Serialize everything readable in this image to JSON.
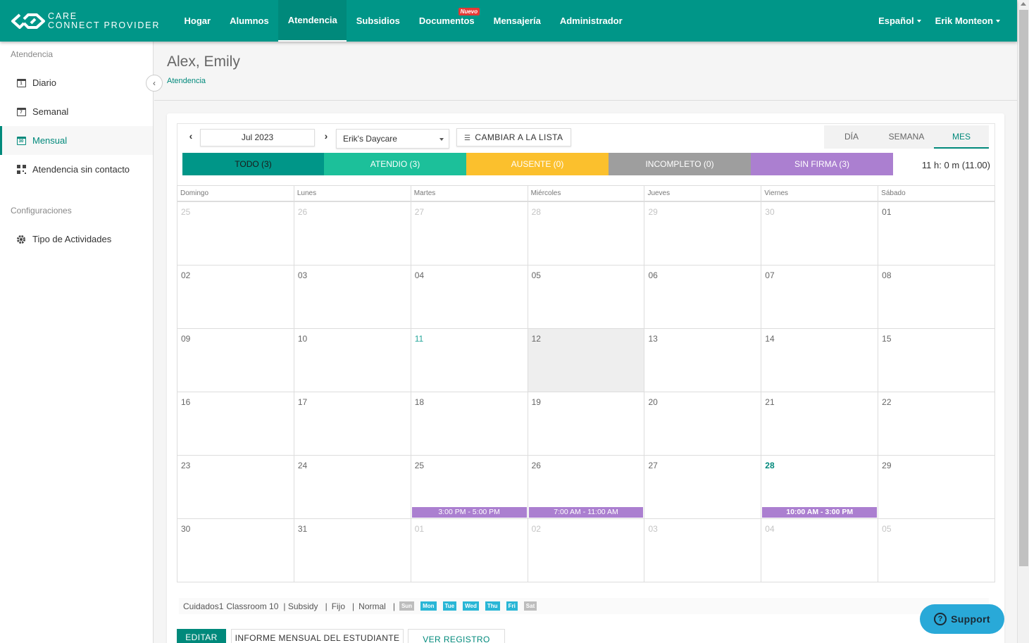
{
  "brand": {
    "line1": "CARE",
    "line2": "CONNECT PROVIDER"
  },
  "nav": {
    "items": [
      {
        "label": "Hogar"
      },
      {
        "label": "Alumnos"
      },
      {
        "label": "Atendencia",
        "active": true
      },
      {
        "label": "Subsidios"
      },
      {
        "label": "Documentos",
        "badge": "Nuevo"
      },
      {
        "label": "Mensajería"
      },
      {
        "label": "Administrador"
      }
    ],
    "language": "Español",
    "user": "Erik Monteon"
  },
  "sidebar": {
    "section1": "Atendencia",
    "items": [
      {
        "label": "Diario",
        "icon": "calendar-day-icon",
        "num": "1"
      },
      {
        "label": "Semanal",
        "icon": "calendar-week-icon",
        "num": "7"
      },
      {
        "label": "Mensual",
        "icon": "calendar-month-icon",
        "num": "30",
        "active": true
      },
      {
        "label": "Atendencia sin contacto",
        "icon": "qr-code-icon"
      }
    ],
    "section2": "Configuraciones",
    "settings_items": [
      {
        "label": "Tipo de Actividades",
        "icon": "gear-icon"
      }
    ]
  },
  "header": {
    "title": "Alex, Emily",
    "breadcrumb": "Atendencia"
  },
  "toolbar": {
    "month": "Jul 2023",
    "daycare": "Erik's Daycare",
    "list_button": "CAMBIAR A LA LISTA",
    "views": [
      "DÍA",
      "SEMANA",
      "MES"
    ],
    "active_view": "MES"
  },
  "filters": [
    {
      "label": "TODO (3)",
      "color": "#009688",
      "text_color": "#1a1a1a"
    },
    {
      "label": "ATENDIO (3)",
      "color": "#1cc09a",
      "text_color": "#ffffff"
    },
    {
      "label": "AUSENTE (0)",
      "color": "#fbc02d",
      "text_color": "#ffffff"
    },
    {
      "label": "INCOMPLETO (0)",
      "color": "#9e9e9e",
      "text_color": "#ffffff"
    },
    {
      "label": "SIN FIRMA (3)",
      "color": "#ab7fd0",
      "text_color": "#ffffff"
    }
  ],
  "total_hours": "11 h: 0 m (11.00)",
  "calendar": {
    "weekdays": [
      "Domingo",
      "Lunes",
      "Martes",
      "Miércoles",
      "Jueves",
      "Viernes",
      "Sábado"
    ],
    "weeks": [
      [
        {
          "d": "25",
          "muted": true
        },
        {
          "d": "26",
          "muted": true
        },
        {
          "d": "27",
          "muted": true
        },
        {
          "d": "28",
          "muted": true
        },
        {
          "d": "29",
          "muted": true
        },
        {
          "d": "30",
          "muted": true
        },
        {
          "d": "01"
        }
      ],
      [
        {
          "d": "02"
        },
        {
          "d": "03"
        },
        {
          "d": "04"
        },
        {
          "d": "05"
        },
        {
          "d": "06"
        },
        {
          "d": "07"
        },
        {
          "d": "08"
        }
      ],
      [
        {
          "d": "09"
        },
        {
          "d": "10"
        },
        {
          "d": "11",
          "green": true
        },
        {
          "d": "12",
          "today": true
        },
        {
          "d": "13"
        },
        {
          "d": "14"
        },
        {
          "d": "15"
        }
      ],
      [
        {
          "d": "16"
        },
        {
          "d": "17"
        },
        {
          "d": "18"
        },
        {
          "d": "19"
        },
        {
          "d": "20"
        },
        {
          "d": "21"
        },
        {
          "d": "22"
        }
      ],
      [
        {
          "d": "23"
        },
        {
          "d": "24"
        },
        {
          "d": "25",
          "event": "3:00 PM - 5:00 PM"
        },
        {
          "d": "26",
          "event": "7:00 AM - 11:00 AM"
        },
        {
          "d": "27"
        },
        {
          "d": "28",
          "bold": true,
          "event": "10:00 AM - 3:00 PM"
        },
        {
          "d": "29"
        }
      ],
      [
        {
          "d": "30"
        },
        {
          "d": "31"
        },
        {
          "d": "01",
          "muted": true
        },
        {
          "d": "02",
          "muted": true
        },
        {
          "d": "03",
          "muted": true
        },
        {
          "d": "04",
          "muted": true
        },
        {
          "d": "05",
          "muted": true
        }
      ]
    ]
  },
  "legend": {
    "care": "Cuidados1",
    "classroom": "Classroom 10",
    "subsidy": "| Subsidy",
    "type": "Fijo",
    "schedule": "Normal",
    "days": [
      {
        "label": "Sun",
        "on": false
      },
      {
        "label": "Mon",
        "on": true
      },
      {
        "label": "Tue",
        "on": true
      },
      {
        "label": "Wed",
        "on": true
      },
      {
        "label": "Thu",
        "on": true
      },
      {
        "label": "Fri",
        "on": true
      },
      {
        "label": "Sat",
        "on": false
      }
    ]
  },
  "buttons": {
    "edit": "EDITAR",
    "report": "INFORME MENSUAL DEL ESTUDIANTE",
    "log": "VER REGISTRO"
  },
  "support": "Support"
}
